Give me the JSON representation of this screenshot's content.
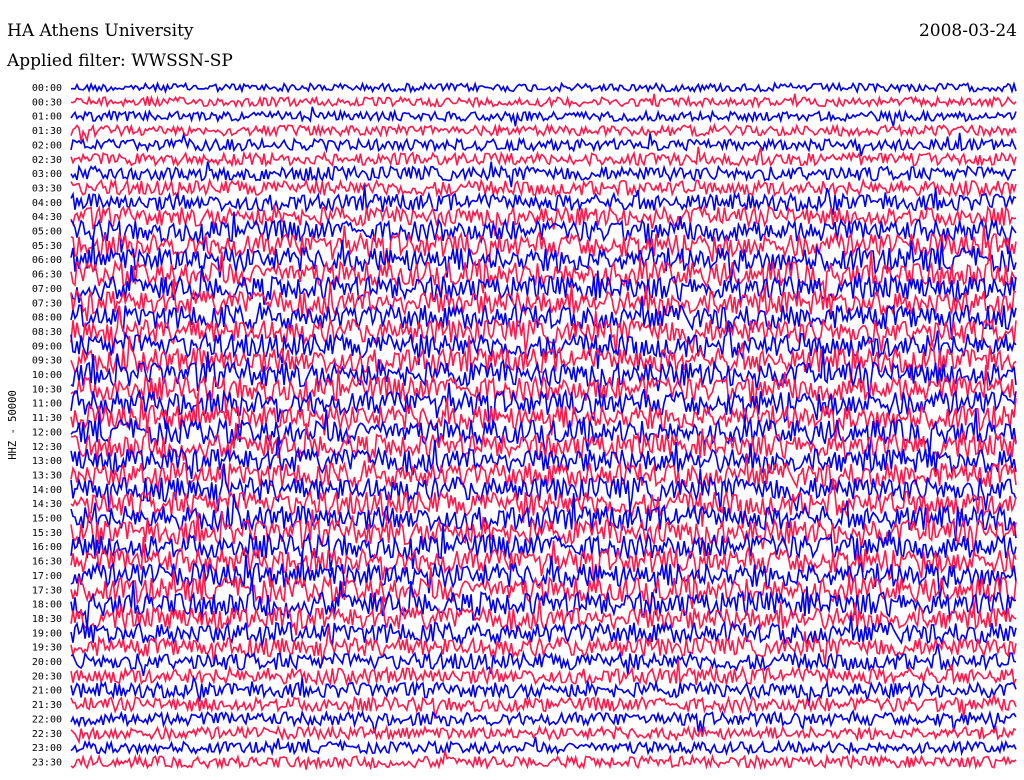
{
  "header": {
    "station": "HA Athens University",
    "date": "2008-03-24",
    "filter_label": "Applied filter: WWSSN-SP"
  },
  "chart_data": {
    "type": "line",
    "kind": "helicorder",
    "ylabel": "HHZ - 50000",
    "row_labels": [
      "00:00",
      "00:30",
      "01:00",
      "01:30",
      "02:00",
      "02:30",
      "03:00",
      "03:30",
      "04:00",
      "04:30",
      "05:00",
      "05:30",
      "06:00",
      "06:30",
      "07:00",
      "07:30",
      "08:00",
      "08:30",
      "09:00",
      "09:30",
      "10:00",
      "10:30",
      "11:00",
      "11:30",
      "12:00",
      "12:30",
      "13:00",
      "13:30",
      "14:00",
      "14:30",
      "15:00",
      "15:30",
      "16:00",
      "16:30",
      "17:00",
      "17:30",
      "18:00",
      "18:30",
      "19:00",
      "19:30",
      "20:00",
      "20:30",
      "21:00",
      "21:30",
      "22:00",
      "22:30",
      "23:00",
      "23:30"
    ],
    "row_colors": [
      "#0000ee",
      "#ff1a4b"
    ],
    "relative_noise_level": [
      0.12,
      0.18,
      0.2,
      0.25,
      0.3,
      0.35,
      0.45,
      0.5,
      0.6,
      0.7,
      0.85,
      0.95,
      1.0,
      1.0,
      1.0,
      1.0,
      1.0,
      1.0,
      1.0,
      1.0,
      1.0,
      1.0,
      1.0,
      1.0,
      1.0,
      1.0,
      1.0,
      1.0,
      1.0,
      1.0,
      1.0,
      1.0,
      1.0,
      1.0,
      1.0,
      1.0,
      1.0,
      0.9,
      0.8,
      0.7,
      0.6,
      0.55,
      0.5,
      0.45,
      0.4,
      0.35,
      0.3,
      0.3
    ],
    "grid": false,
    "legend": "none"
  }
}
